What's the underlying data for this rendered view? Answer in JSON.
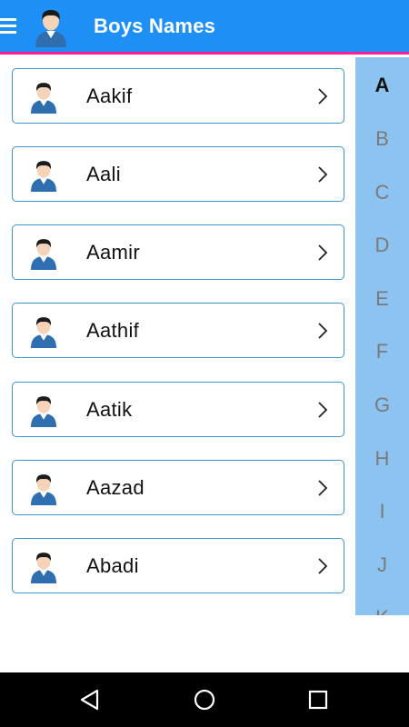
{
  "header": {
    "title": "Boys Names",
    "menu_icon": "hamburger-menu-icon",
    "avatar_icon": "boy-avatar-icon"
  },
  "names": [
    {
      "label": "Aakif"
    },
    {
      "label": "Aali"
    },
    {
      "label": "Aamir"
    },
    {
      "label": "Aathif"
    },
    {
      "label": "Aatik"
    },
    {
      "label": "Aazad"
    },
    {
      "label": "Abadi"
    }
  ],
  "alphabet": {
    "letters": [
      "A",
      "B",
      "C",
      "D",
      "E",
      "F",
      "G",
      "H",
      "I",
      "J",
      "K"
    ],
    "selected": "A"
  },
  "nav": {
    "back_icon": "back-triangle-icon",
    "home_icon": "home-circle-icon",
    "recents_icon": "recents-square-icon"
  },
  "colors": {
    "toolbar": "#1e90f5",
    "accent_line": "#ff1e9a",
    "card_border": "#3b97c4",
    "index_bg": "#8cc3f0"
  }
}
